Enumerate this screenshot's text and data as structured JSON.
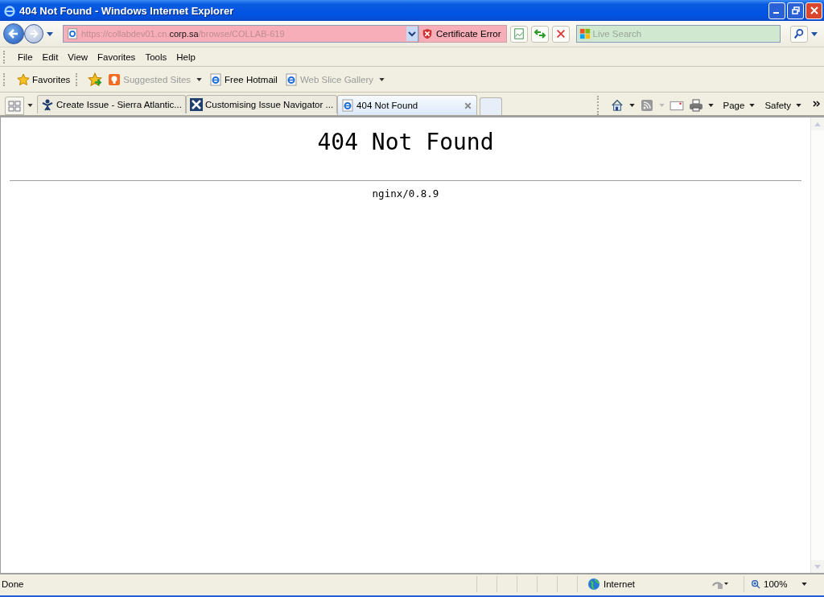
{
  "window": {
    "title": "404 Not Found - Windows Internet Explorer"
  },
  "address": {
    "url_parts": [
      {
        "text": "https://collabdev01.cn.",
        "dim": true
      },
      {
        "text": "corp.sa",
        "dim": false
      },
      {
        "text": "/browse/COLLAB-619",
        "dim": true
      }
    ],
    "certificate": "Certificate Error"
  },
  "search": {
    "placeholder": "Live Search"
  },
  "menu": [
    "File",
    "Edit",
    "View",
    "Favorites",
    "Tools",
    "Help"
  ],
  "favorites_bar": [
    {
      "kind": "star",
      "label": "Favorites",
      "dim": false,
      "dropdown": false
    },
    {
      "kind": "suggested",
      "label": "Suggested Sites",
      "dim": true,
      "dropdown": true
    },
    {
      "kind": "ie",
      "label": "Free Hotmail",
      "dim": false,
      "dropdown": false
    },
    {
      "kind": "ie",
      "label": "Web Slice Gallery",
      "dim": true,
      "dropdown": true
    }
  ],
  "tabs": [
    {
      "kind": "person",
      "label": "Create Issue - Sierra Atlantic...",
      "selected": false
    },
    {
      "kind": "cross",
      "label": "Customising Issue Navigator ...",
      "selected": false
    },
    {
      "kind": "ie",
      "label": "404 Not Found",
      "selected": true
    }
  ],
  "command_bar": [
    "Page",
    "Safety"
  ],
  "page": {
    "heading": "404 Not Found",
    "footer": "nginx/0.8.9"
  },
  "status_bar": {
    "status": "Done",
    "zone": "Internet",
    "zoom": "100%"
  }
}
